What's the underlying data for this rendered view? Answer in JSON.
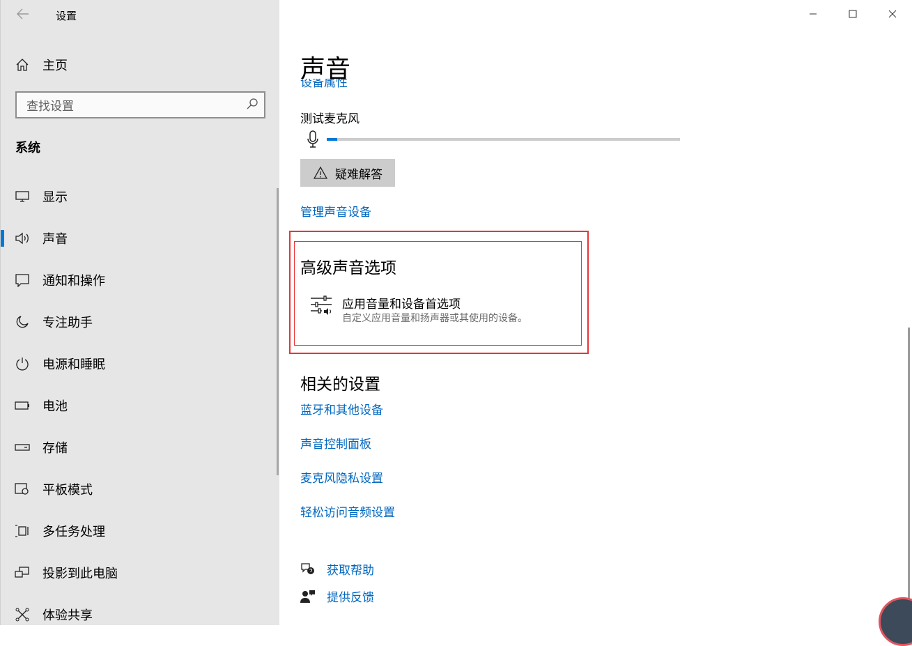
{
  "app": {
    "title": "设置",
    "back_icon": "back-arrow-icon"
  },
  "sidebar": {
    "home_label": "主页",
    "search_placeholder": "查找设置",
    "section": "系统",
    "items": [
      {
        "label": "显示",
        "icon": "monitor-icon"
      },
      {
        "label": "声音",
        "icon": "speaker-icon",
        "active": true
      },
      {
        "label": "通知和操作",
        "icon": "notification-icon"
      },
      {
        "label": "专注助手",
        "icon": "moon-icon"
      },
      {
        "label": "电源和睡眠",
        "icon": "power-icon"
      },
      {
        "label": "电池",
        "icon": "battery-icon"
      },
      {
        "label": "存储",
        "icon": "storage-icon"
      },
      {
        "label": "平板模式",
        "icon": "tablet-icon"
      },
      {
        "label": "多任务处理",
        "icon": "multitask-icon"
      },
      {
        "label": "投影到此电脑",
        "icon": "project-icon"
      },
      {
        "label": "体验共享",
        "icon": "share-icon"
      }
    ]
  },
  "main": {
    "title": "声音",
    "clipped_link": "设备属性",
    "mic_test_label": "测试麦克风",
    "mic_level": 0.03,
    "troubleshoot_label": "疑难解答",
    "manage_devices_link": "管理声音设备",
    "advanced": {
      "title": "高级声音选项",
      "item_title": "应用音量和设备首选项",
      "item_desc": "自定义应用音量和扬声器或其使用的设备。"
    },
    "related": {
      "title": "相关的设置",
      "links": [
        "蓝牙和其他设备",
        "声音控制面板",
        "麦克风隐私设置",
        "轻松访问音频设置"
      ]
    },
    "help": {
      "get_help": "获取帮助",
      "feedback": "提供反馈"
    }
  },
  "colors": {
    "accent": "#0078d7",
    "link": "#0067c0",
    "highlight": "#e83434",
    "sidebar_bg": "#e6e6e6"
  }
}
